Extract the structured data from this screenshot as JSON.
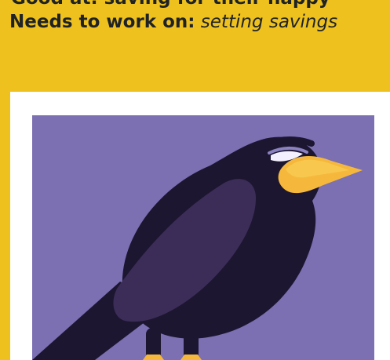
{
  "header": {
    "partial_top_text": "Good at: saving for their happy",
    "needs_label": "Needs to work on:",
    "needs_value": "setting savings"
  },
  "colors": {
    "background_yellow": "#efc11e",
    "card_white": "#ffffff",
    "illustration_purple": "#7c6fb2",
    "crow_body": "#1d1630",
    "crow_wing": "#3b2d58",
    "beak": "#f5b83c"
  },
  "illustration": {
    "icon": "crow-icon"
  }
}
